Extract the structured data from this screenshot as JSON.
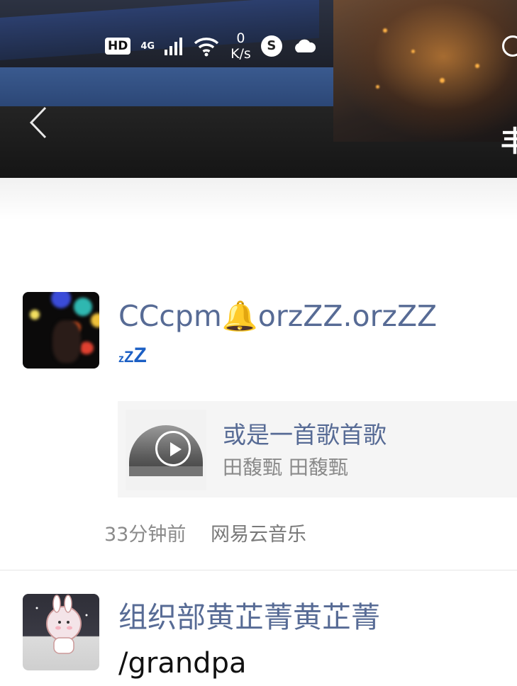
{
  "status_bar": {
    "hd": "HD",
    "network": "4G",
    "speed_value": "0",
    "speed_unit": "K/s"
  },
  "header": {
    "cover_glyph": "丰"
  },
  "posts": [
    {
      "name": "CCcpm🔔orzZZ.orzZZ",
      "name_suffix": "zZZ",
      "music": {
        "title": "或是一首歌首歌",
        "artist": "田馥甄 田馥甄"
      },
      "time": "33分钟前",
      "source": "网易云音乐"
    },
    {
      "name": "组织部黄芷菁黄芷菁",
      "name_line2": "/grandpa"
    }
  ],
  "colors": {
    "name_link": "#576b95",
    "meta_gray": "#8a8a8a",
    "card_bg": "#f5f5f5"
  }
}
